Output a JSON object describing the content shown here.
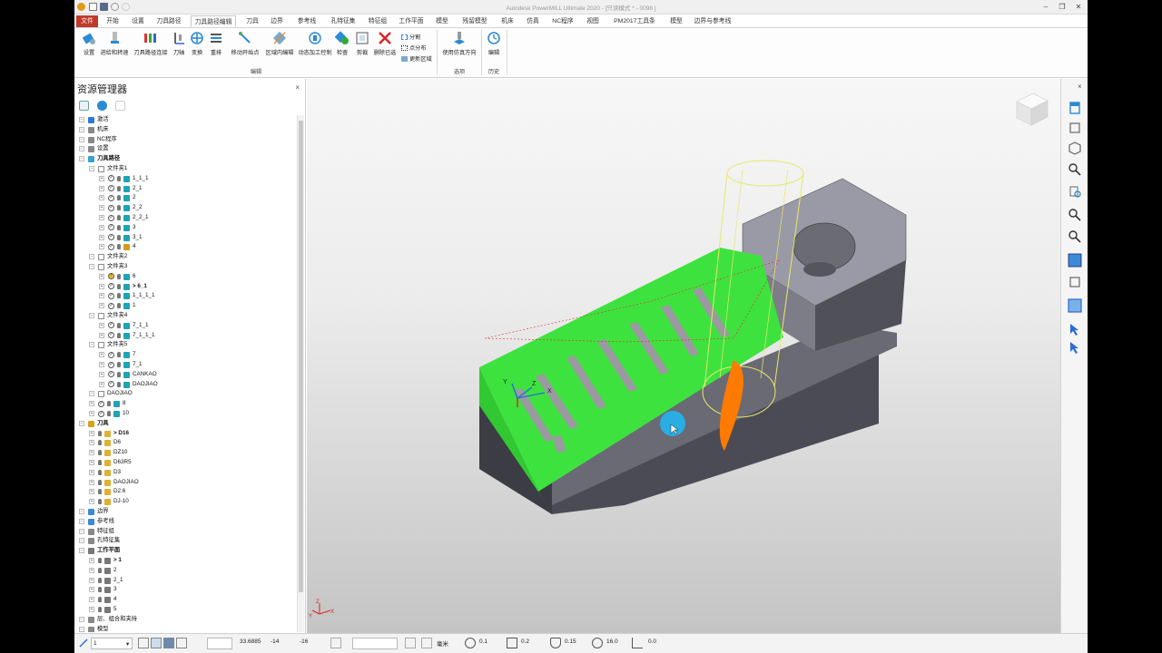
{
  "titlebar": {
    "title": "Autodesk PowerMILL Ultimate 2020 - [只读模式 * - 0098 ]"
  },
  "ribbon_tabs": [
    "文件",
    "开始",
    "设置",
    "刀具路径",
    "刀具路径编辑",
    "刀具",
    "边界",
    "参考线",
    "孔特征集",
    "特征组",
    "工作平面",
    "模型",
    "残留模型",
    "机床",
    "仿真",
    "NC程序",
    "视图",
    "PM2017工具条",
    "模型",
    "边界与参考线"
  ],
  "ribbon": {
    "buttons": [
      "设置",
      "进给和转速",
      "刀具路径连接",
      "刀轴",
      "变换",
      "重排",
      "移动开始点",
      "区域内编辑",
      "动态加工控制",
      "检查",
      "剪裁",
      "删除已选"
    ],
    "small_buttons": [
      "分割",
      "点分布",
      "更新区域"
    ],
    "options_button": "使用仿真方向",
    "history_button": "编辑",
    "groups": {
      "edit": "编辑",
      "options": "选项",
      "history": "历史"
    }
  },
  "explorer": {
    "title": "资源管理器",
    "close": "×",
    "tree": [
      {
        "t": "激活",
        "lvl": 0,
        "icon": "active-icon",
        "color": "#2b7bd6"
      },
      {
        "t": "机床",
        "lvl": 0,
        "icon": "machine-icon",
        "color": "#888888"
      },
      {
        "t": "NC程序",
        "lvl": 0,
        "icon": "nc-program-icon",
        "color": "#888888"
      },
      {
        "t": "设置",
        "lvl": 0,
        "icon": "settings-icon",
        "color": "#888888"
      },
      {
        "t": "刀具路径",
        "lvl": 0,
        "icon": "toolpath-icon",
        "color": "#3aa0d6",
        "bold": true
      },
      {
        "t": "文件夹1",
        "lvl": 1,
        "icon": "folder-icon",
        "color": "#ffffff"
      },
      {
        "t": "1_1_1",
        "lvl": 2,
        "icon": "toolpath-icon",
        "color": "#1fa3b5",
        "chk": "✓"
      },
      {
        "t": "2_1",
        "lvl": 2,
        "icon": "toolpath-icon",
        "color": "#1fa3b5",
        "chk": "✓"
      },
      {
        "t": "2",
        "lvl": 2,
        "icon": "toolpath-icon",
        "color": "#1fa3b5",
        "chk": "✓"
      },
      {
        "t": "2_2",
        "lvl": 2,
        "icon": "toolpath-icon",
        "color": "#1fa3b5",
        "chk": "✓"
      },
      {
        "t": "2_2_1",
        "lvl": 2,
        "icon": "toolpath-icon",
        "color": "#1fa3b5",
        "chk": "✓"
      },
      {
        "t": "3",
        "lvl": 2,
        "icon": "toolpath-icon",
        "color": "#1fa3b5",
        "chk": "✓"
      },
      {
        "t": "3_1",
        "lvl": 2,
        "icon": "toolpath-icon",
        "color": "#1fa3b5",
        "chk": "✓"
      },
      {
        "t": "4",
        "lvl": 2,
        "icon": "toolpath-icon",
        "color": "#d69a1f",
        "chk": "✓"
      },
      {
        "t": "文件夹2",
        "lvl": 1,
        "icon": "folder-icon",
        "color": "#ffffff"
      },
      {
        "t": "文件夹3",
        "lvl": 1,
        "icon": "folder-icon",
        "color": "#ffffff"
      },
      {
        "t": "6",
        "lvl": 2,
        "icon": "toolpath-icon",
        "color": "#1fa3b5",
        "chk": "!"
      },
      {
        "t": "> 6_1",
        "lvl": 2,
        "icon": "toolpath-icon",
        "color": "#1fa3b5",
        "chk": "✓",
        "bold": true
      },
      {
        "t": "1_1_1_1",
        "lvl": 2,
        "icon": "toolpath-icon",
        "color": "#1fa3b5",
        "chk": "✓"
      },
      {
        "t": "1",
        "lvl": 2,
        "icon": "toolpath-icon",
        "color": "#1fa3b5",
        "chk": "✓"
      },
      {
        "t": "文件夹4",
        "lvl": 1,
        "icon": "folder-icon",
        "color": "#ffffff"
      },
      {
        "t": "7_1_1",
        "lvl": 2,
        "icon": "toolpath-icon",
        "color": "#1fa3b5",
        "chk": "✓"
      },
      {
        "t": "7_1_1_1",
        "lvl": 2,
        "icon": "toolpath-icon",
        "color": "#1fa3b5",
        "chk": "✓"
      },
      {
        "t": "文件夹5",
        "lvl": 1,
        "icon": "folder-icon",
        "color": "#ffffff"
      },
      {
        "t": "7",
        "lvl": 2,
        "icon": "toolpath-icon",
        "color": "#1fa3b5",
        "chk": "✓"
      },
      {
        "t": "7_1",
        "lvl": 2,
        "icon": "toolpath-icon",
        "color": "#1fa3b5",
        "chk": "✓"
      },
      {
        "t": "CANKAO",
        "lvl": 2,
        "icon": "toolpath-icon",
        "color": "#1fa3b5",
        "chk": "✓"
      },
      {
        "t": "DAOJIAO",
        "lvl": 2,
        "icon": "toolpath-icon",
        "color": "#1fa3b5",
        "chk": "✓"
      },
      {
        "t": "DAOJIAO",
        "lvl": 1,
        "icon": "folder-icon",
        "color": "#ffffff"
      },
      {
        "t": "8",
        "lvl": 1,
        "icon": "toolpath-icon",
        "color": "#1fa3b5",
        "chk": "✓"
      },
      {
        "t": "10",
        "lvl": 1,
        "icon": "toolpath-icon",
        "color": "#1fa3b5",
        "chk": "✓"
      },
      {
        "t": "刀具",
        "lvl": 0,
        "icon": "tool-icon",
        "color": "#d6a21f",
        "bold": true
      },
      {
        "t": "> D16",
        "lvl": 1,
        "icon": "tool-icon",
        "color": "#e0b030",
        "bold": true
      },
      {
        "t": "D6",
        "lvl": 1,
        "icon": "tool-icon",
        "color": "#e0b030"
      },
      {
        "t": "DZ10",
        "lvl": 1,
        "icon": "tool-icon",
        "color": "#e0b030"
      },
      {
        "t": "D63R5",
        "lvl": 1,
        "icon": "tool-icon",
        "color": "#e0b030"
      },
      {
        "t": "D3",
        "lvl": 1,
        "icon": "tool-icon",
        "color": "#e0b030"
      },
      {
        "t": "DAOJIAO",
        "lvl": 1,
        "icon": "tool-icon",
        "color": "#e0b030"
      },
      {
        "t": "D2.6",
        "lvl": 1,
        "icon": "tool-icon",
        "color": "#e0b030"
      },
      {
        "t": "DJ-10",
        "lvl": 1,
        "icon": "tool-icon",
        "color": "#e0b030"
      },
      {
        "t": "边界",
        "lvl": 0,
        "icon": "boundary-icon",
        "color": "#3a8ad6"
      },
      {
        "t": "参考线",
        "lvl": 0,
        "icon": "pattern-icon",
        "color": "#3a8ad6"
      },
      {
        "t": "特征组",
        "lvl": 0,
        "icon": "feature-icon",
        "color": "#888888"
      },
      {
        "t": "孔特征集",
        "lvl": 0,
        "icon": "hole-icon",
        "color": "#888888"
      },
      {
        "t": "工作平面",
        "lvl": 0,
        "icon": "workplane-icon",
        "color": "#777777",
        "bold": true
      },
      {
        "t": "> 1",
        "lvl": 1,
        "icon": "workplane-icon",
        "color": "#777777",
        "bold": true
      },
      {
        "t": "2",
        "lvl": 1,
        "icon": "workplane-icon",
        "color": "#777777"
      },
      {
        "t": "2_1",
        "lvl": 1,
        "icon": "workplane-icon",
        "color": "#777777"
      },
      {
        "t": "3",
        "lvl": 1,
        "icon": "workplane-icon",
        "color": "#777777"
      },
      {
        "t": "4",
        "lvl": 1,
        "icon": "workplane-icon",
        "color": "#777777"
      },
      {
        "t": "5",
        "lvl": 1,
        "icon": "workplane-icon",
        "color": "#777777"
      },
      {
        "t": "层、组合和夹持",
        "lvl": 0,
        "icon": "layers-icon",
        "color": "#888888"
      },
      {
        "t": "模型",
        "lvl": 0,
        "icon": "model-icon",
        "color": "#888888"
      }
    ]
  },
  "viewport": {
    "triad_labels": {
      "x": "X",
      "y": "Y",
      "z": "Z"
    },
    "corner_triad": {
      "x": "X",
      "y": "Y",
      "z": "Z"
    }
  },
  "status": {
    "workplane": "1",
    "x": "33.6885",
    "y": "-14",
    "z": "-16",
    "units": "毫米",
    "tolerance": "0.1",
    "thickness": "0.2",
    "tool_dia": "0.15",
    "rapid": "16.0",
    "value2": "0.0"
  },
  "colors": {
    "file_tab": "#c0392b",
    "model_green": "#3ee23e",
    "model_gray": "#8c8c96",
    "tool_yellow": "#e8e86a",
    "cutter_orange": "#ff7a00"
  }
}
